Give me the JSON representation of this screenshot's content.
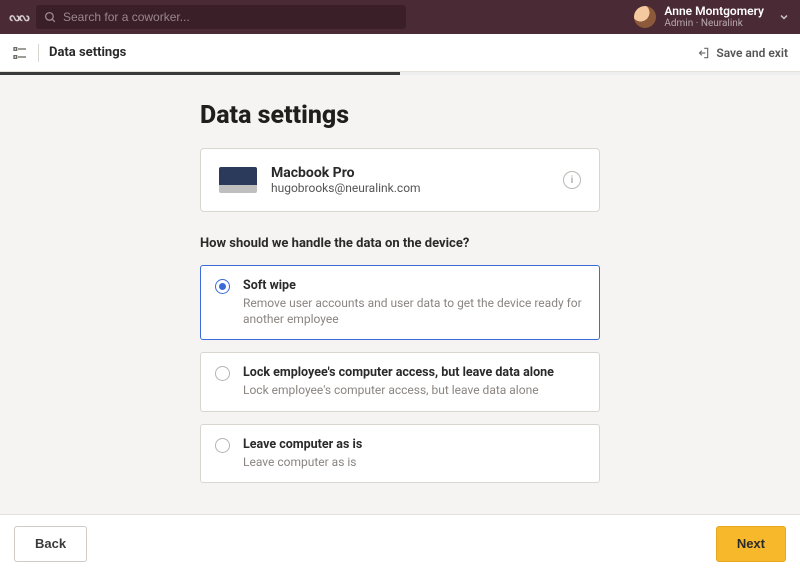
{
  "topbar": {
    "search_placeholder": "Search for a coworker...",
    "user": {
      "name": "Anne Montgomery",
      "role_line": "Admin · Neuralink"
    }
  },
  "pagebar": {
    "title": "Data settings",
    "save_exit_label": "Save and exit"
  },
  "progress": {
    "percent": 50
  },
  "page": {
    "title": "Data settings",
    "device": {
      "name": "Macbook Pro",
      "email": "hugobrooks@neuralink.com"
    },
    "question": "How should we handle the data on the device?",
    "options": [
      {
        "id": "soft-wipe",
        "title": "Soft wipe",
        "description": "Remove user accounts and user data to get the device ready for another employee",
        "selected": true
      },
      {
        "id": "lock-access",
        "title": "Lock employee's computer access, but leave data alone",
        "description": "Lock employee's computer access, but leave data alone",
        "selected": false
      },
      {
        "id": "leave-as-is",
        "title": "Leave computer as is",
        "description": "Leave computer as is",
        "selected": false
      }
    ]
  },
  "footer": {
    "back_label": "Back",
    "next_label": "Next"
  }
}
